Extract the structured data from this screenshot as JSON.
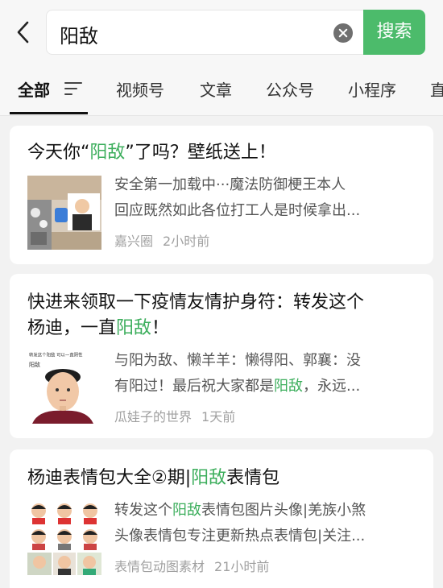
{
  "search": {
    "query": "阳敌",
    "button_label": "搜索"
  },
  "tabs": [
    {
      "label": "全部",
      "active": true
    },
    {
      "label": "视频号"
    },
    {
      "label": "文章"
    },
    {
      "label": "公众号"
    },
    {
      "label": "小程序"
    },
    {
      "label": "直"
    }
  ],
  "accent_color": "#3cae5c",
  "results": [
    {
      "title_before": "今天你“",
      "title_highlight": "阳敌",
      "title_after": "”了吗？壁纸送上！",
      "snippet_line1": "安全第一加载中···魔法防御梗王本人",
      "snippet_line2": "回应既然如此各位打工人是时候拿出...",
      "source": "嘉兴圈",
      "time": "2小时前"
    },
    {
      "title_line1": "快进来领取一下疫情友情护身符：转发这个",
      "title_line2_before": "杨迪，一直",
      "title_highlight": "阳敌",
      "title_line2_after": "！",
      "thumb_caption": "转发这个阳敌 可以一直阴性",
      "thumb_caption2": "阳敌",
      "snippet_line1": "与阳为敌、懒羊羊：懒得阳、郭襄：没",
      "snippet_line2_before": "有阳过！最后祝大家都是",
      "snippet_highlight": "阳敌",
      "snippet_line2_after": "，永远...",
      "source": "瓜娃子的世界",
      "time": "1天前"
    },
    {
      "title_before": "杨迪表情包大全②期|",
      "title_highlight": "阳敌",
      "title_after": "表情包",
      "snippet_line1_before": "转发这个",
      "snippet_highlight": "阳敌",
      "snippet_line1_after": "表情包图片头像|羌族小煞",
      "snippet_line2": "头像表情包专注更新热点表情包|关注...",
      "source": "表情包动图素材",
      "time": "21小时前"
    }
  ]
}
